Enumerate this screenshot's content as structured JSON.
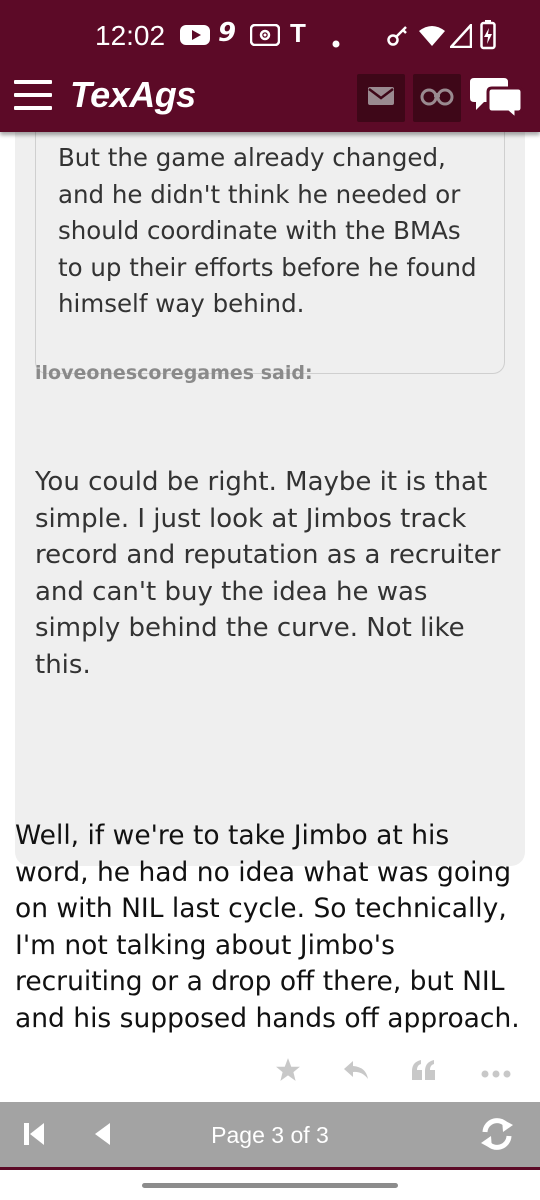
{
  "status_bar": {
    "time": "12:02",
    "icons": [
      "youtube-icon",
      "nine-app-icon",
      "radio-icon",
      "t-app-icon",
      "dot-icon",
      "key-icon",
      "wifi-icon",
      "signal-icon",
      "battery-icon"
    ],
    "t_glyph": "T",
    "nine_glyph": "9"
  },
  "app_bar": {
    "logo": "TexAgs",
    "buttons": [
      "mail-icon",
      "binoculars-icon",
      "chat-bubbles-icon"
    ]
  },
  "thread": {
    "nested_quote": "But the game already changed, and he didn't think he needed or should coordinate with the BMAs to up their efforts before he found himself way behind.",
    "quote_author_line": "iloveonescoregames said:",
    "quote_text": "You could be right. Maybe it is that simple. I just look at Jimbos track record and reputation as a recruiter and can't buy the idea he was simply behind the curve. Not like this.",
    "post_body": "Well, if we're to take Jimbo at his word, he had no idea what was going on with NIL last cycle. So technically, I'm not talking about Jimbo's recruiting or a drop off there, but NIL and his supposed hands off approach."
  },
  "post_actions": [
    "star-icon",
    "reply-icon",
    "quote-icon",
    "more-icon"
  ],
  "pager": {
    "label": "Page 3 of 3"
  },
  "colors": {
    "brand_maroon": "#5c0a27",
    "quote_bg": "#efefef",
    "pager_bg": "#a3a3a3"
  }
}
